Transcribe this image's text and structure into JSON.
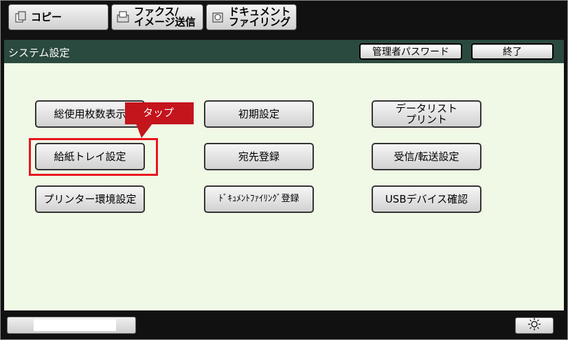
{
  "tabs": [
    {
      "label": "コピー",
      "icon": "copy-icon"
    },
    {
      "label": "ファクス/\nイメージ送信",
      "icon": "fax-icon"
    },
    {
      "label": "ドキュメント\nファイリング",
      "icon": "document-filing-icon"
    }
  ],
  "header": {
    "title": "システム設定",
    "admin_password_label": "管理者パスワード",
    "exit_label": "終了"
  },
  "buttons": {
    "total_count": "総使用枚数表示",
    "initial_settings": "初期設定",
    "data_list_print": "データリスト\nプリント",
    "paper_tray": "給紙トレイ設定",
    "address_registration": "宛先登録",
    "receive_forward": "受信/転送設定",
    "printer_env": "プリンター環境設定",
    "doc_filing_registration": "ﾄﾞｷｭﾒﾝﾄﾌｧｲﾘﾝｸﾞ登録",
    "usb_device_check": "USBデバイス確認"
  },
  "callout": {
    "label": "タップ"
  },
  "colors": {
    "header_bg": "#2b4a3f",
    "panel_bg": "#f0f8e6",
    "highlight": "#e8141e",
    "callout_bg": "#c4141c"
  },
  "footer": {
    "brightness_icon": "brightness-icon"
  }
}
